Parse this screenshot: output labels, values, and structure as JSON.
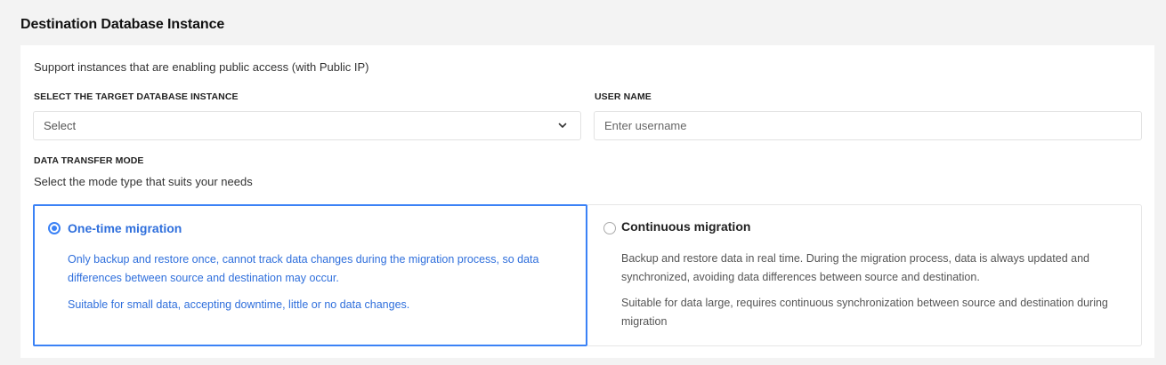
{
  "section": {
    "title": "Destination Database Instance"
  },
  "support_text": "Support instances that are enabling public access (with Public IP)",
  "target_instance": {
    "label": "SELECT THE TARGET DATABASE INSTANCE",
    "value": "Select",
    "icon": "chevron-down-icon"
  },
  "username": {
    "label": "USER NAME",
    "placeholder": "Enter username",
    "value": ""
  },
  "transfer_mode": {
    "label": "DATA TRANSFER MODE",
    "subtitle": "Select the mode type that suits your needs",
    "options": [
      {
        "title": "One-time migration",
        "selected": true,
        "desc1": "Only backup and restore once, cannot track data changes during the migration process, so data differences between source and destination may occur.",
        "desc2": "Suitable for small data, accepting downtime, little or no data changes."
      },
      {
        "title": "Continuous migration",
        "selected": false,
        "desc1": "Backup and restore data in real time. During the migration process, data is always updated and synchronized, avoiding data differences between source and destination.",
        "desc2": "Suitable for data large, requires continuous synchronization between source and destination during migration"
      }
    ]
  },
  "colors": {
    "accent": "#3b82f6",
    "accent_text": "#2f6fdc",
    "background": "#f3f3f3",
    "card": "#ffffff"
  }
}
